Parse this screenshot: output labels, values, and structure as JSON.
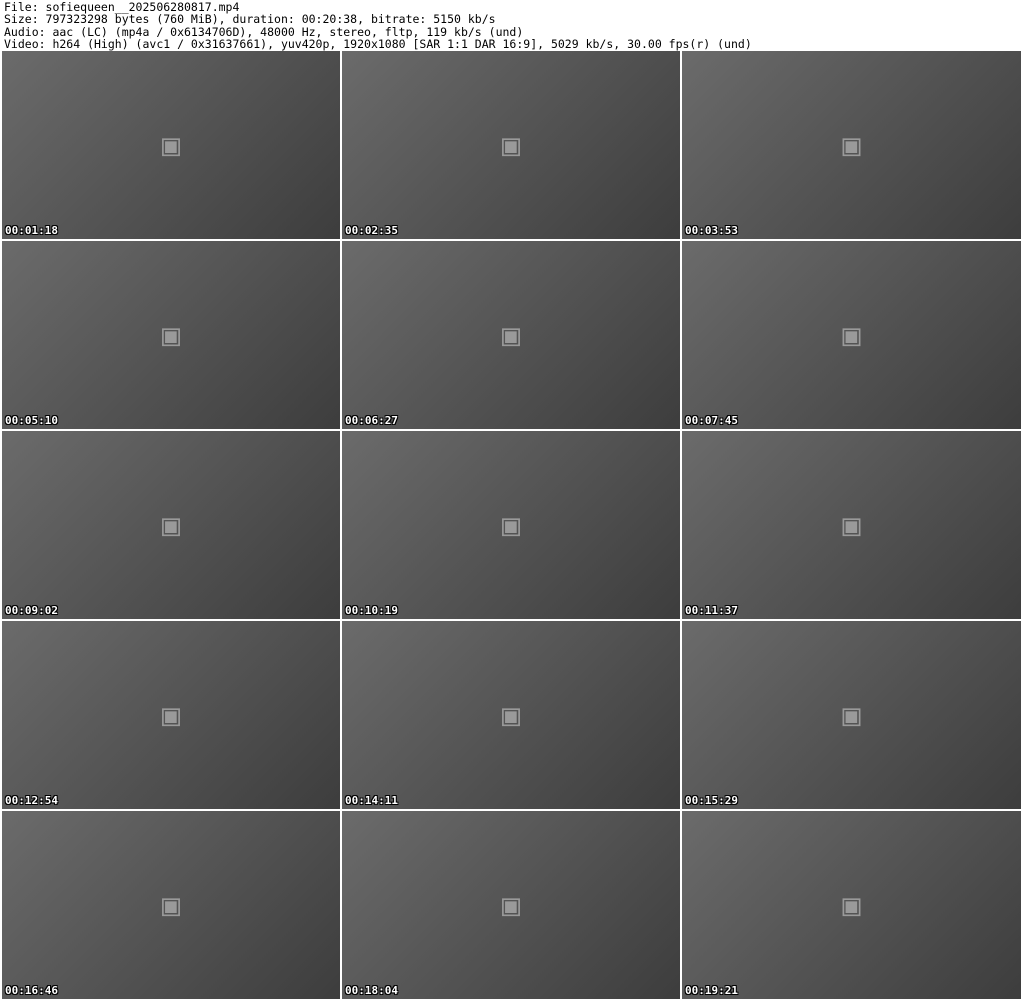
{
  "header": {
    "file": "File: sofiequeen__202506280817.mp4",
    "size": "Size: 797323298 bytes (760 MiB), duration: 00:20:38, bitrate: 5150 kb/s",
    "audio": "Audio: aac (LC) (mp4a / 0x6134706D), 48000 Hz, stereo, fltp, 119 kb/s (und)",
    "video": "Video: h264 (High) (avc1 / 0x31637661), yuv420p, 1920x1080 [SAR 1:1 DAR 16:9], 5029 kb/s, 30.00 fps(r) (und)"
  },
  "thumbnails": [
    {
      "timestamp": "00:01:18"
    },
    {
      "timestamp": "00:02:35"
    },
    {
      "timestamp": "00:03:53"
    },
    {
      "timestamp": "00:05:10"
    },
    {
      "timestamp": "00:06:27"
    },
    {
      "timestamp": "00:07:45"
    },
    {
      "timestamp": "00:09:02"
    },
    {
      "timestamp": "00:10:19"
    },
    {
      "timestamp": "00:11:37"
    },
    {
      "timestamp": "00:12:54"
    },
    {
      "timestamp": "00:14:11"
    },
    {
      "timestamp": "00:15:29"
    },
    {
      "timestamp": "00:16:46"
    },
    {
      "timestamp": "00:18:04"
    },
    {
      "timestamp": "00:19:21"
    }
  ]
}
